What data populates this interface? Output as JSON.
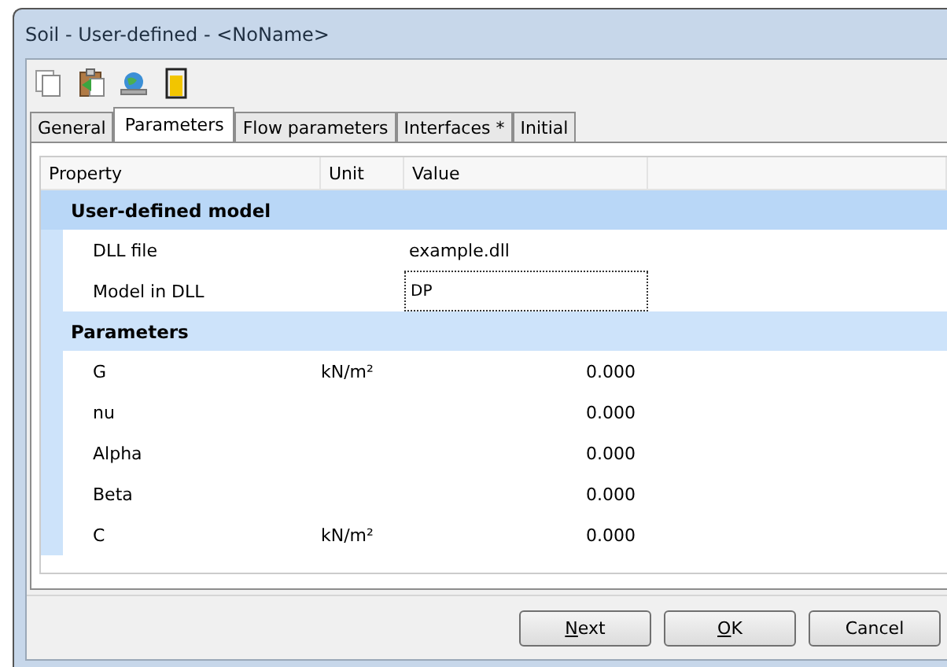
{
  "window": {
    "title": "Soil - User-defined - <NoName>"
  },
  "tabs": [
    {
      "label": "General",
      "selected": false
    },
    {
      "label": "Parameters",
      "selected": true
    },
    {
      "label": "Flow parameters",
      "selected": false
    },
    {
      "label": "Interfaces *",
      "selected": false
    },
    {
      "label": "Initial",
      "selected": false
    }
  ],
  "table": {
    "columns": [
      "Property",
      "Unit",
      "Value"
    ],
    "groups": [
      {
        "title": "User-defined model",
        "rows": [
          {
            "property": "DLL file",
            "value": "example.dll",
            "kind": "text",
            "focused": false
          },
          {
            "property": "Model in DLL",
            "value": "DP",
            "kind": "text",
            "focused": true
          }
        ]
      },
      {
        "title": "Parameters",
        "rows": [
          {
            "property": "G",
            "unit": "kN/m²",
            "value": "0.000",
            "kind": "number",
            "focused": false
          },
          {
            "property": "nu",
            "value": "0.000",
            "kind": "number",
            "focused": false
          },
          {
            "property": "Alpha",
            "value": "0.000",
            "kind": "number",
            "focused": false
          },
          {
            "property": "Beta",
            "value": "0.000",
            "kind": "number",
            "focused": false
          },
          {
            "property": "C",
            "unit": "kN/m²",
            "value": "0.000",
            "kind": "number",
            "focused": false
          }
        ]
      }
    ]
  },
  "buttons": [
    {
      "label": "Next",
      "mnemonic": true
    },
    {
      "label": "OK",
      "mnemonic": true
    },
    {
      "label": "Cancel",
      "mnemonic": false
    }
  ]
}
